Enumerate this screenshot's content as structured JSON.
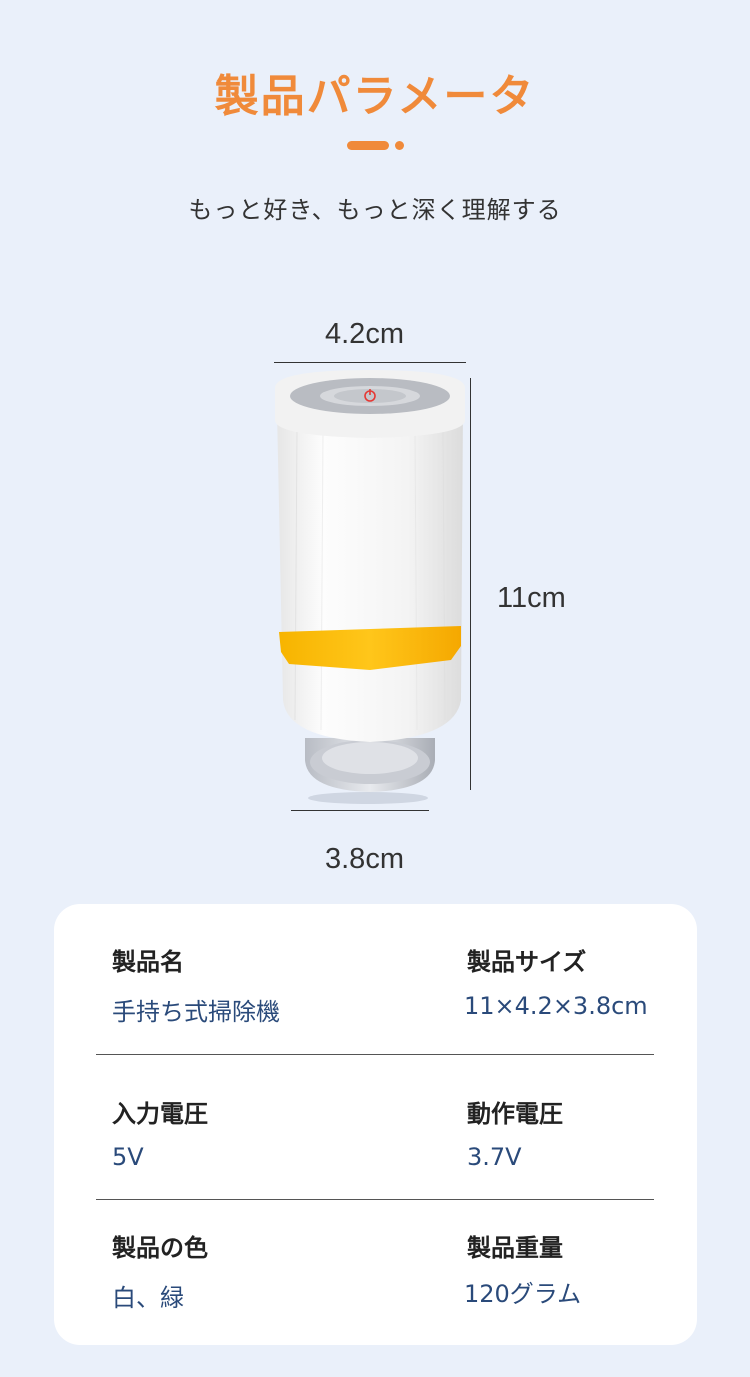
{
  "header": {
    "title": "製品パラメータ",
    "subtitle": "もっと好き、もっと深く理解する"
  },
  "dimensions": {
    "width_top": "4.2cm",
    "height": "11cm",
    "width_bottom": "3.8cm"
  },
  "specs": {
    "rows": [
      {
        "left_label": "製品名",
        "left_value": "手持ち式掃除機",
        "right_label": "製品サイズ",
        "right_value": "11×4.2×3.8cm"
      },
      {
        "left_label": "入力電圧",
        "left_value": "5V",
        "right_label": "動作電圧",
        "right_value": "3.7V"
      },
      {
        "left_label": "製品の色",
        "left_value": "白、緑",
        "right_label": "製品重量",
        "right_value": "120グラム"
      }
    ]
  },
  "colors": {
    "accent": "#f08a3a",
    "background": "#eaf0fa",
    "value_text": "#2a4a7a",
    "product_band": "#ffbf00"
  }
}
